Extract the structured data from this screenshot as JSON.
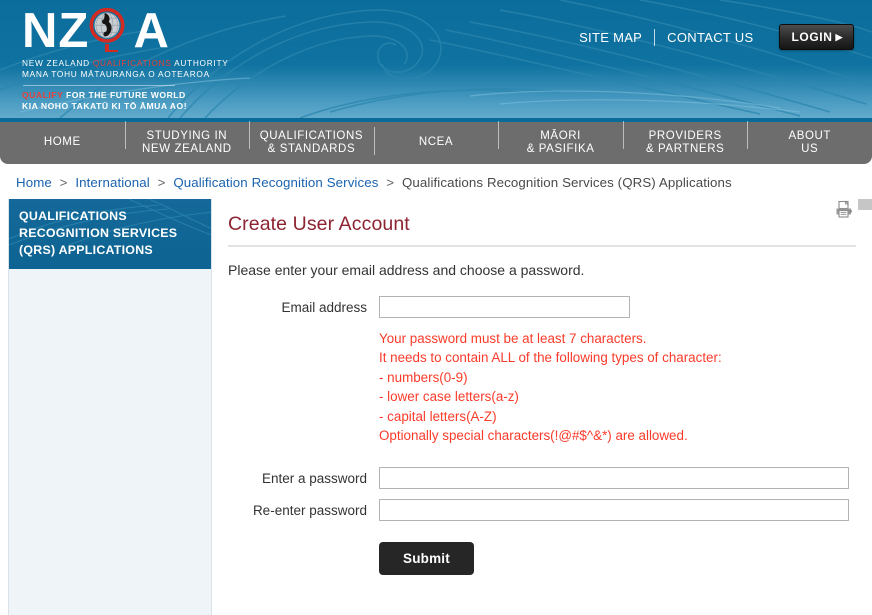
{
  "header": {
    "logo": {
      "letters_prefix": "NZ",
      "letters_suffix": "A",
      "globe_icon": "nz-globe-icon",
      "line1_a": "NEW ZEALAND ",
      "line1_b": "QUALIFICATIONS",
      "line1_c": " AUTHORITY",
      "line2": "MANA TOHU MĀTAURANGA O AOTEAROA",
      "tagline1_a": "QUALIFY",
      "tagline1_b": " FOR THE FUTURE WORLD",
      "tagline2": "KIA NOHO TAKATŪ KI TŌ ĀMUA AO!"
    },
    "top_links": [
      {
        "label": "SITE MAP",
        "name": "site-map-link"
      },
      {
        "label": "CONTACT US",
        "name": "contact-us-link"
      }
    ],
    "login_button": "LOGIN",
    "login_arrow": "▶"
  },
  "nav": {
    "items": [
      {
        "line1": "HOME",
        "line2": ""
      },
      {
        "line1": "STUDYING IN",
        "line2": "NEW ZEALAND"
      },
      {
        "line1": "QUALIFICATIONS",
        "line2": "& STANDARDS"
      },
      {
        "line1": "NCEA",
        "line2": ""
      },
      {
        "line1": "MĀORI",
        "line2": "& PASIFIKA"
      },
      {
        "line1": "PROVIDERS",
        "line2": "& PARTNERS"
      },
      {
        "line1": "ABOUT",
        "line2": "US"
      }
    ]
  },
  "breadcrumb": {
    "items": [
      {
        "label": "Home",
        "link": true
      },
      {
        "label": "International",
        "link": true
      },
      {
        "label": "Qualification Recognition Services",
        "link": true
      },
      {
        "label": "Qualifications Recognition Services (QRS) Applications",
        "link": false
      }
    ],
    "separator": ">"
  },
  "sidebar": {
    "heading": "QUALIFICATIONS RECOGNITION SERVICES (QRS) APPLICATIONS"
  },
  "main": {
    "print_icon": "printer-icon",
    "title": "Create User Account",
    "intro": "Please enter your email address and choose a password.",
    "fields": {
      "email_label": "Email address",
      "email_value": "",
      "email_placeholder": "",
      "password_label": "Enter a password",
      "password_value": "",
      "password_placeholder": "",
      "confirm_label": "Re-enter password",
      "confirm_value": "",
      "confirm_placeholder": ""
    },
    "password_rules": [
      "Your password must be at least 7 characters.",
      "It needs to contain ALL of the following types of character:",
      "- numbers(0-9)",
      "- lower case letters(a-z)",
      "- capital letters(A-Z)",
      "Optionally special characters(!@#$^&*) are allowed."
    ],
    "submit_label": "Submit"
  },
  "colors": {
    "header_blue": "#0f72a0",
    "nav_gray": "#6d6d6d",
    "accent_red": "#e8403a",
    "title_maroon": "#8d2431",
    "error_red": "#fb3b2a",
    "link_blue": "#1b63b0",
    "sidebar_bg": "#eff4f8"
  }
}
